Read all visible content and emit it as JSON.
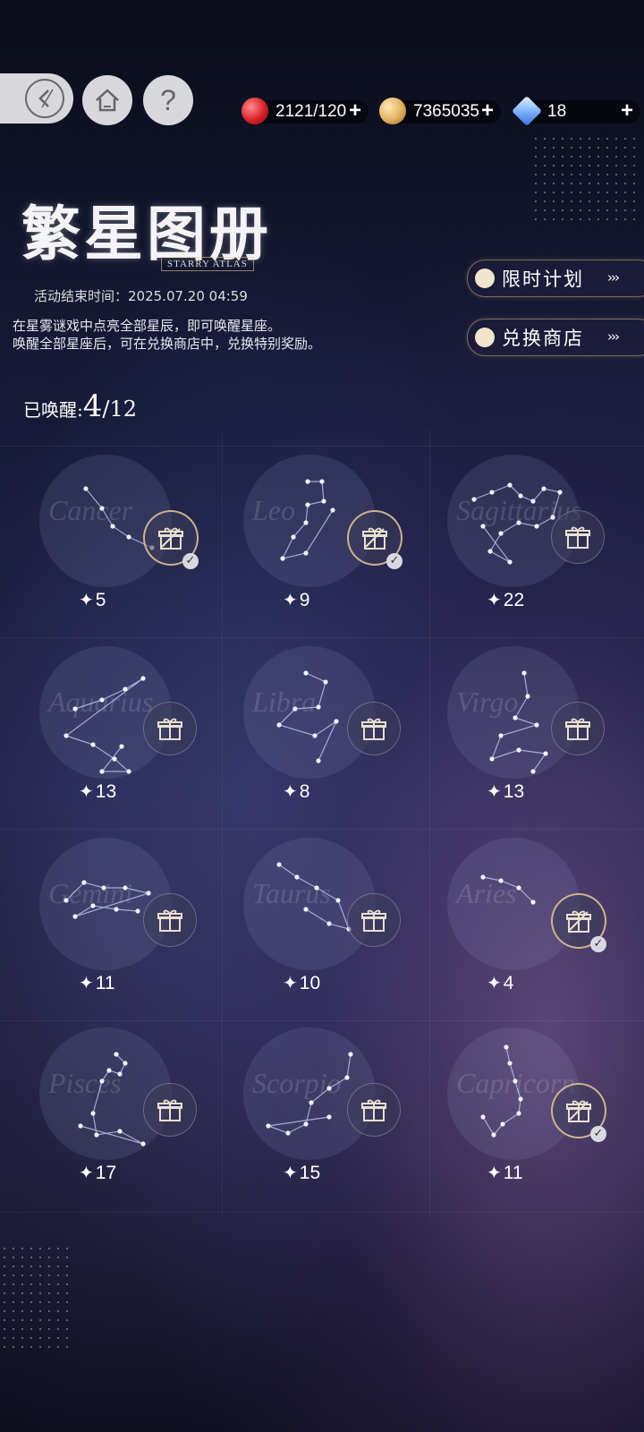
{
  "topbar": {
    "energy": "2121/120",
    "coins": "7365035",
    "gems": "18",
    "plus": "+"
  },
  "header": {
    "title": "繁星图册",
    "subtitle_en": "STARRY ATLAS",
    "end_time": "活动结束时间：2025.07.20 04:59",
    "desc_line1": "在星雾谜戏中点亮全部星辰，即可唤醒星座。",
    "desc_line2": "唤醒全部星座后，可在兑换商店中，兑换特别奖励。",
    "awakened_label": "已唤醒:",
    "awakened_current": "4",
    "awakened_total": "/12"
  },
  "side_buttons": {
    "plan_label": "限时计划",
    "shop_label": "兑换商店",
    "arrows": "›››"
  },
  "constellations": [
    {
      "latin": "Cancer",
      "count": "5",
      "claimed": true
    },
    {
      "latin": "Leo",
      "count": "9",
      "claimed": true
    },
    {
      "latin": "Sagittarius",
      "count": "22",
      "claimed": false
    },
    {
      "latin": "Aquarius",
      "count": "13",
      "claimed": false
    },
    {
      "latin": "Libra",
      "count": "8",
      "claimed": false
    },
    {
      "latin": "Virgo",
      "count": "13",
      "claimed": false
    },
    {
      "latin": "Gemini",
      "count": "11",
      "claimed": false
    },
    {
      "latin": "Taurus",
      "count": "10",
      "claimed": false
    },
    {
      "latin": "Aries",
      "count": "4",
      "claimed": true
    },
    {
      "latin": "Pisces",
      "count": "17",
      "claimed": false
    },
    {
      "latin": "Scorpio",
      "count": "15",
      "claimed": false
    },
    {
      "latin": "Capricorn",
      "count": "11",
      "claimed": true
    }
  ],
  "star_symbol": "✦"
}
